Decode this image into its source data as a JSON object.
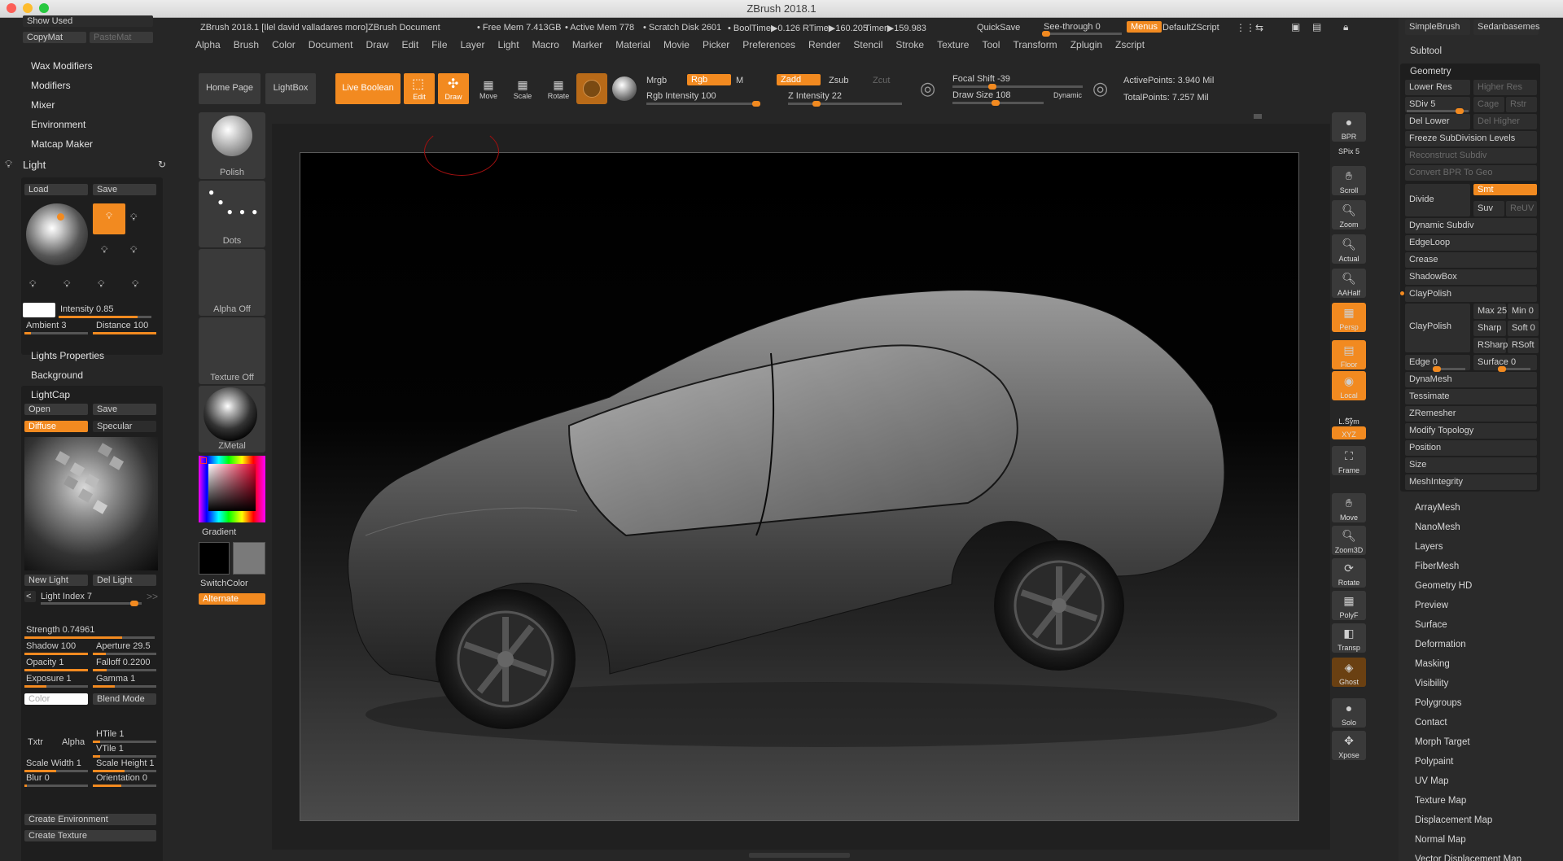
{
  "window": {
    "title": "ZBrush 2018.1"
  },
  "infobar": {
    "doc": "ZBrush 2018.1 [Ilel david valladares moro]ZBrush Document",
    "free_mem": "• Free Mem 7.413GB",
    "active_mem": "• Active Mem 778",
    "scratch": "• Scratch Disk 2601",
    "booltime": "• BoolTime▶0.126",
    "rtime": "RTime▶160.205",
    "timer": "Timer▶159.983",
    "quicksave": "QuickSave",
    "see_through": "See-through  0",
    "menus": "Menus",
    "default_zscript": "DefaultZScript"
  },
  "menu": [
    "Alpha",
    "Brush",
    "Color",
    "Document",
    "Draw",
    "Edit",
    "File",
    "Layer",
    "Light",
    "Macro",
    "Marker",
    "Material",
    "Movie",
    "Picker",
    "Preferences",
    "Render",
    "Stencil",
    "Stroke",
    "Texture",
    "Tool",
    "Transform",
    "Zplugin",
    "Zscript"
  ],
  "toolbar": {
    "home_page": "Home Page",
    "lightbox": "LightBox",
    "live_boolean": "Live Boolean",
    "edit": "Edit",
    "draw": "Draw",
    "move": "Move",
    "scale": "Scale",
    "rotate": "Rotate",
    "mrgb": "Mrgb",
    "rgb": "Rgb",
    "m": "M",
    "zadd": "Zadd",
    "zsub": "Zsub",
    "zcut": "Zcut",
    "rgb_intensity": "Rgb Intensity 100",
    "z_intensity": "Z Intensity 22",
    "focal_shift": "Focal Shift -39",
    "draw_size": "Draw Size 108",
    "dynamic": "Dynamic",
    "active_points": "ActivePoints: 3.940 Mil",
    "total_points": "TotalPoints: 7.257 Mil"
  },
  "left": {
    "show_used": "Show Used",
    "copymat": "CopyMat",
    "pastemat": "PasteMat",
    "wax_modifiers": "Wax Modifiers",
    "modifiers": "Modifiers",
    "mixer": "Mixer",
    "environment": "Environment",
    "matcap_maker": "Matcap Maker",
    "light_title": "Light",
    "load": "Load",
    "save": "Save",
    "intensity": "Intensity 0.85",
    "ambient": "Ambient 3",
    "distance": "Distance 100",
    "lights_properties": "Lights Properties",
    "background": "Background",
    "lightcap": "LightCap",
    "open": "Open",
    "save2": "Save",
    "diffuse": "Diffuse",
    "specular": "Specular",
    "new_light": "New Light",
    "del_light": "Del Light",
    "light_index": "Light Index 7",
    "strength": "Strength 0.74961",
    "shadow": "Shadow 100",
    "aperture": "Aperture 29.5",
    "opacity": "Opacity 1",
    "falloff": "Falloff 0.2200",
    "exposure": "Exposure 1",
    "gamma": "Gamma 1",
    "color": "Color",
    "blend_mode": "Blend Mode",
    "txtr": "Txtr",
    "alpha": "Alpha",
    "htile": "HTile 1",
    "vtile": "VTile 1",
    "scale_width": "Scale Width 1",
    "scale_height": "Scale Height 1",
    "blur": "Blur 0",
    "orientation": "Orientation 0",
    "create_environment": "Create Environment",
    "create_texture": "Create Texture"
  },
  "tools": {
    "polish": "Polish",
    "dots": "Dots",
    "alpha_off": "Alpha Off",
    "texture_off": "Texture Off",
    "zmetal": "ZMetal",
    "gradient": "Gradient",
    "switchcolor": "SwitchColor",
    "alternate": "Alternate"
  },
  "shelf": [
    "BPR",
    "SPix 5",
    "Scroll",
    "Zoom",
    "Actual",
    "AAHalf",
    "Persp",
    "Floor",
    "Local",
    "L.Sym",
    "XYZ",
    "Frame",
    "Move",
    "Zoom3D",
    "Rotate",
    "PolyF",
    "Transp",
    "Ghost",
    "Solo",
    "Xpose"
  ],
  "right": {
    "simplebrush": "SimpleBrush",
    "sedanbasemesh": "Sedanbasemes",
    "subtool": "Subtool",
    "geometry": "Geometry",
    "lower_res": "Lower Res",
    "higher_res": "Higher Res",
    "sdiv": "SDiv 5",
    "cage": "Cage",
    "rstr": "Rstr",
    "del_lower": "Del Lower",
    "del_higher": "Del Higher",
    "freeze": "Freeze SubDivision Levels",
    "reconstruct": "Reconstruct Subdiv",
    "convert_bpr": "Convert BPR To Geo",
    "divide": "Divide",
    "smt": "Smt",
    "suv": "Suv",
    "reuv": "ReUV",
    "dynamic_subdiv": "Dynamic Subdiv",
    "edgeloop": "EdgeLoop",
    "crease": "Crease",
    "shadowbox": "ShadowBox",
    "claypolish_header": "ClayPolish",
    "claypolish": "ClayPolish",
    "max": "Max 25",
    "min": "Min 0",
    "sharp": "Sharp",
    "soft": "Soft 0",
    "rsharp": "RSharp",
    "rsoft": "RSoft",
    "edge": "Edge 0",
    "surface0": "Surface 0",
    "dynamesh": "DynaMesh",
    "tessimate": "Tessimate",
    "zremesher": "ZRemesher",
    "modify_topology": "Modify Topology",
    "position": "Position",
    "size": "Size",
    "meshintegrity": "MeshIntegrity",
    "list": [
      "ArrayMesh",
      "NanoMesh",
      "Layers",
      "FiberMesh",
      "Geometry HD",
      "Preview",
      "Surface",
      "Deformation",
      "Masking",
      "Visibility",
      "Polygroups",
      "Contact",
      "Morph Target",
      "Polypaint",
      "UV Map",
      "Texture Map",
      "Displacement Map",
      "Normal Map",
      "Vector Displacement Map"
    ]
  },
  "colors": {
    "accent": "#f28a20",
    "panel": "#262626",
    "button": "#3a3a3a"
  }
}
